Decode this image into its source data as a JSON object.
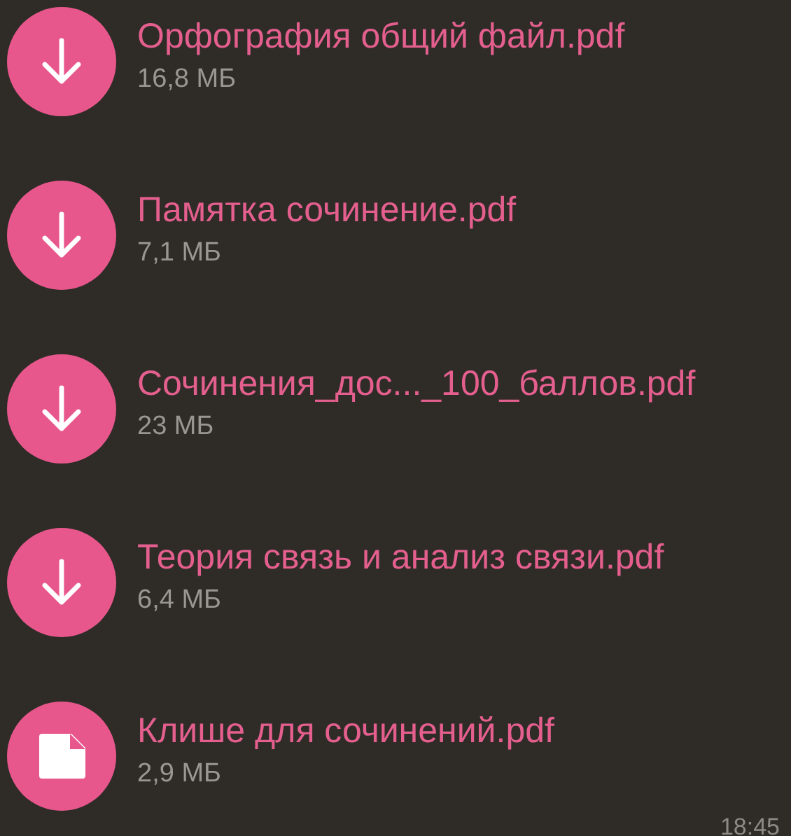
{
  "files": [
    {
      "name": "Орфография общий файл.pdf",
      "size": "16,8 МБ",
      "kind": "download"
    },
    {
      "name": "Памятка сочинение.pdf",
      "size": "7,1 МБ",
      "kind": "download"
    },
    {
      "name": "Сочинения_дос..._100_баллов.pdf",
      "size": "23 МБ",
      "kind": "download"
    },
    {
      "name": "Теория связь и анализ связи.pdf",
      "size": "6,4 МБ",
      "kind": "download"
    },
    {
      "name": "Клише для сочинений.pdf",
      "size": "2,9 МБ",
      "kind": "document"
    }
  ],
  "time": "18:45"
}
